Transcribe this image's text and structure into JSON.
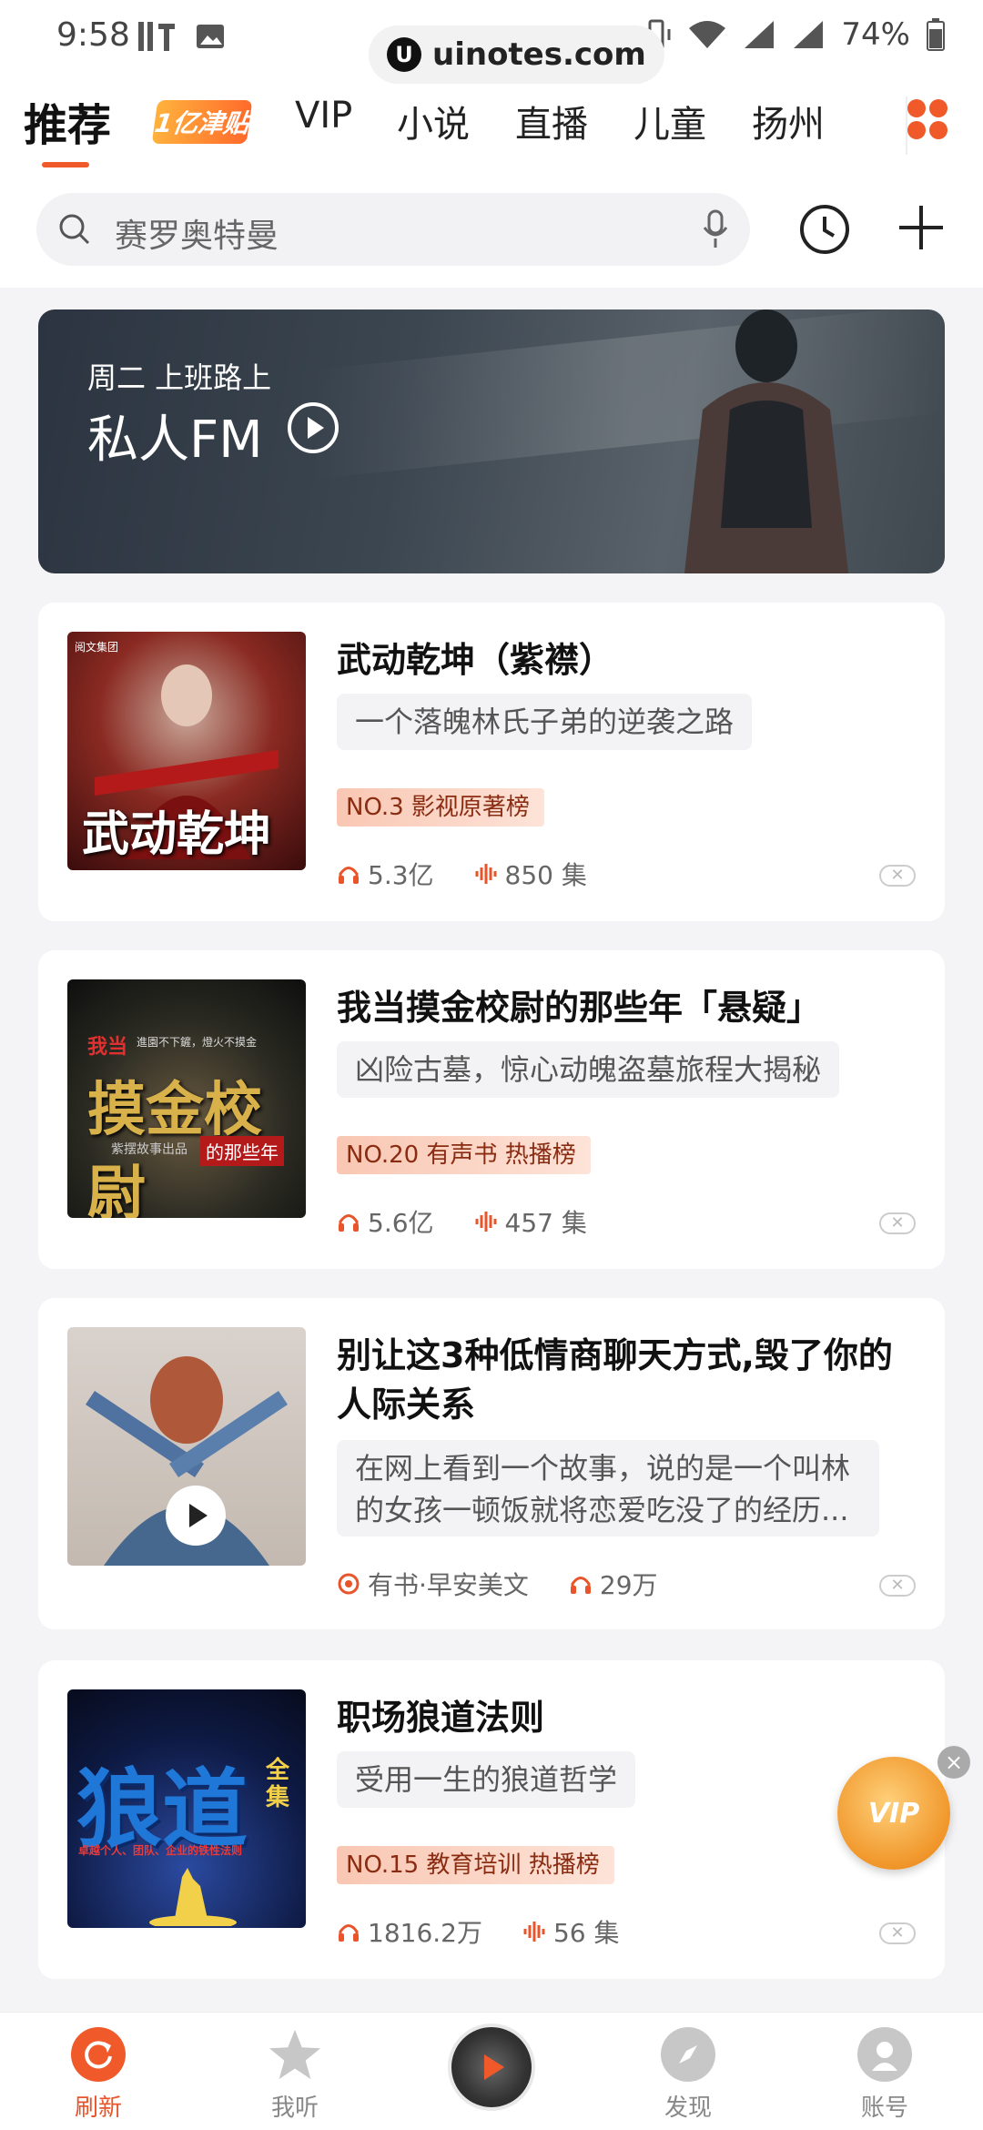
{
  "status_bar": {
    "time": "9:58",
    "battery": "74%"
  },
  "watermark": {
    "text": "uinotes.com"
  },
  "tabs": [
    {
      "label": "推荐"
    },
    {
      "label": "1亿津贴"
    },
    {
      "label": "VIP"
    },
    {
      "label": "小说"
    },
    {
      "label": "直播"
    },
    {
      "label": "儿童"
    },
    {
      "label": "扬州"
    }
  ],
  "search": {
    "placeholder": "赛罗奥特曼"
  },
  "fm_banner": {
    "subtitle": "周二 上班路上",
    "title": "私人FM"
  },
  "cards": [
    {
      "title": "武动乾坤（紫襟）",
      "description": "一个落魄林氏子弟的逆袭之路",
      "rank": "NO.3 影视原著榜",
      "plays": "5.3亿",
      "episodes": "850 集",
      "cover_text": "武动乾坤",
      "cover_publisher": "阅文集团"
    },
    {
      "title": "我当摸金校尉的那些年「悬疑」",
      "description": "凶险古墓，惊心动魄盗墓旅程大揭秘",
      "rank": "NO.20 有声书 热播榜",
      "plays": "5.6亿",
      "episodes": "457 集",
      "cover_text": "摸金校尉",
      "cover_top": "我当",
      "cover_sub": "的那些年",
      "cover_small": "進園不下鏟，燈火不摸金",
      "cover_publisher": "紫摆故事出品"
    },
    {
      "title": "别让这3种低情商聊天方式,毁了你的人际关系",
      "description": "在网上看到一个故事，说的是一个叫林的女孩一顿饭就将恋爱吃没了的经历...",
      "author": "有书·早安美文",
      "plays": "29万"
    },
    {
      "title": "职场狼道法则",
      "description": "受用一生的狼道哲学",
      "rank": "NO.15 教育培训 热播榜",
      "plays": "1816.2万",
      "episodes": "56 集",
      "cover_text": "狼道",
      "cover_badge": "全集",
      "cover_caption": "卓越个人、团队、企业的铁性法则"
    }
  ],
  "vip_float": {
    "label": "VIP"
  },
  "bottom_nav": [
    {
      "label": "刷新"
    },
    {
      "label": "我听"
    },
    {
      "label": "发现"
    },
    {
      "label": "账号"
    }
  ],
  "colors": {
    "accent": "#f05a2a",
    "rank_bg": "#f9c7b3"
  }
}
